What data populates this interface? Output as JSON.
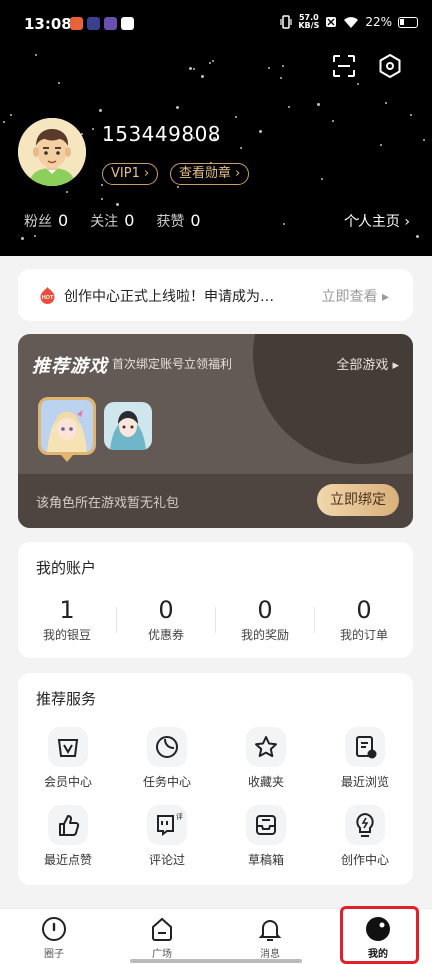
{
  "status_bar": {
    "time": "13:08",
    "net_speed_value": "57.0",
    "net_speed_unit": "KB/S",
    "battery": "22%"
  },
  "profile": {
    "username": "153449808",
    "vip_badge": "VIP1 ›",
    "medal_badge": "查看勋章 ›",
    "stats": [
      {
        "label": "粉丝",
        "value": "0"
      },
      {
        "label": "关注",
        "value": "0"
      },
      {
        "label": "获赞",
        "value": "0"
      }
    ],
    "homepage_link": "个人主页 ›"
  },
  "notice": {
    "badge": "HOT",
    "text": "创作中心正式上线啦！申请成为…",
    "action": "立即查看 ▸"
  },
  "games": {
    "title": "推荐游戏",
    "subtitle": "首次绑定账号立领福利",
    "all_link": "全部游戏 ▸",
    "note": "该角色所在游戏暂无礼包",
    "bind_button": "立即绑定"
  },
  "account": {
    "title": "我的账户",
    "items": [
      {
        "value": "1",
        "label": "我的银豆"
      },
      {
        "value": "0",
        "label": "优惠券"
      },
      {
        "value": "0",
        "label": "我的奖励"
      },
      {
        "value": "0",
        "label": "我的订单"
      }
    ]
  },
  "services": {
    "title": "推荐服务",
    "items": [
      {
        "label": "会员中心",
        "icon": "crown-bag-icon"
      },
      {
        "label": "任务中心",
        "icon": "moon-icon"
      },
      {
        "label": "收藏夹",
        "icon": "star-icon"
      },
      {
        "label": "最近浏览",
        "icon": "history-doc-icon"
      },
      {
        "label": "最近点赞",
        "icon": "thumbs-up-icon"
      },
      {
        "label": "评论过",
        "icon": "comment-icon"
      },
      {
        "label": "草稿箱",
        "icon": "drafts-icon"
      },
      {
        "label": "创作中心",
        "icon": "lightbulb-icon"
      }
    ]
  },
  "tabs": [
    {
      "label": "圈子",
      "icon": "circle-icon"
    },
    {
      "label": "广场",
      "icon": "plaza-icon"
    },
    {
      "label": "消息",
      "icon": "bell-icon"
    },
    {
      "label": "我的",
      "icon": "me-icon",
      "active": true
    }
  ],
  "colors": {
    "gold_accent": "#e6bd8a",
    "highlight_red": "#e0202a"
  }
}
